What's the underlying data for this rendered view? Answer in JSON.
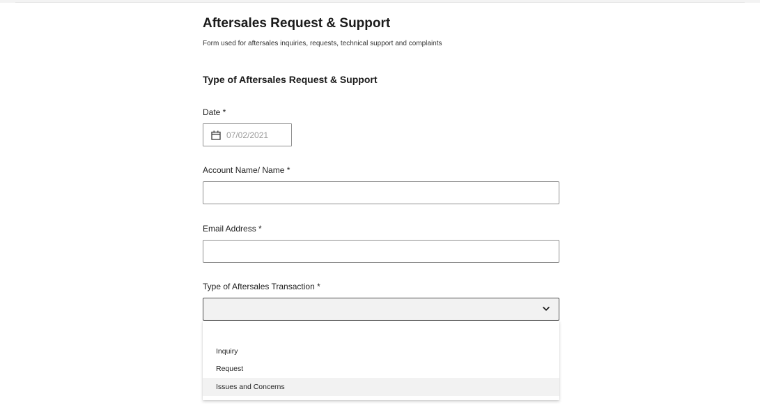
{
  "form": {
    "title": "Aftersales Request & Support",
    "subtitle": "Form used for aftersales inquiries, requests, technical support and complaints",
    "section_title": "Type of Aftersales Request & Support"
  },
  "fields": {
    "date": {
      "label": "Date *",
      "value": "07/02/2021",
      "icon": "calendar-icon"
    },
    "name": {
      "label": "Account Name/ Name *",
      "value": ""
    },
    "email": {
      "label": "Email Address *",
      "value": ""
    },
    "transaction": {
      "label": "Type of Aftersales Transaction *",
      "selected": "",
      "icon": "chevron-down-icon",
      "options": [
        "",
        "Inquiry",
        "Request",
        "Issues and Concerns"
      ],
      "highlighted_option": "Issues and Concerns"
    }
  },
  "colors": {
    "highlight": "#f2f2f2",
    "border": "#8f8f8f",
    "text": "#1f1f1f",
    "placeholder": "#9b9b9b"
  }
}
